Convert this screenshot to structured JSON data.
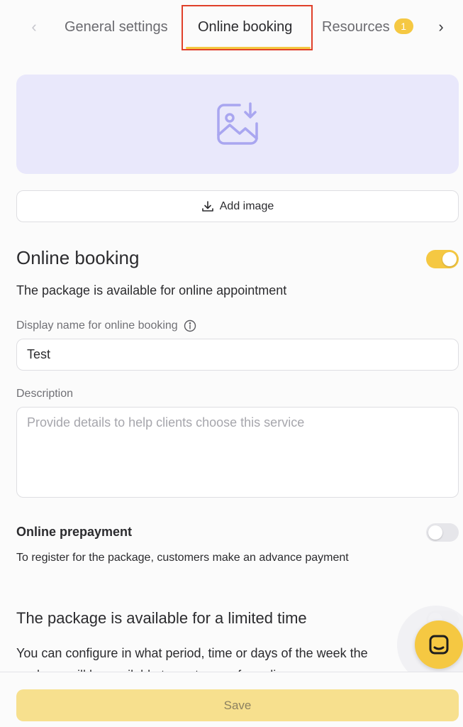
{
  "tabs": {
    "items": [
      {
        "label": "General settings"
      },
      {
        "label": "Online booking",
        "active": true
      },
      {
        "label": "Resources",
        "badge": "1"
      }
    ]
  },
  "image_section": {
    "add_image_label": "Add image"
  },
  "online_booking": {
    "title": "Online booking",
    "enabled": true,
    "subtitle": "The package is available for online appointment",
    "display_name_label": "Display name for online booking",
    "display_name_value": "Test",
    "description_label": "Description",
    "description_placeholder": "Provide details to help clients choose this service"
  },
  "prepayment": {
    "title": "Online prepayment",
    "enabled": false,
    "description": "To register for the package, customers make an advance payment"
  },
  "limited_time": {
    "title": "The package is available for a limited time",
    "enabled": false,
    "description": "You can configure in what period, time or days of the week the package will be available to customers for online"
  },
  "footer": {
    "save_label": "Save"
  },
  "colors": {
    "accent": "#f5c842",
    "highlight_border": "#e0402a",
    "image_placeholder_bg": "#e9e8fb",
    "image_icon": "#a9a6f0"
  }
}
